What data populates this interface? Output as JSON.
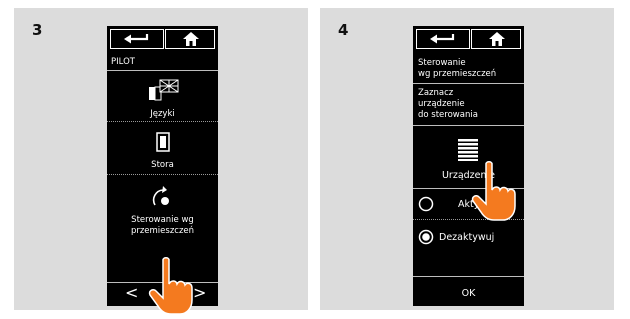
{
  "panels": [
    {
      "step": "3",
      "header": "PILOT",
      "items": [
        {
          "label": "Języki",
          "icon": "language-flags-icon"
        },
        {
          "label": "Stora",
          "icon": "blind-device-icon"
        },
        {
          "label_line1": "Sterowanie wg",
          "label_line2": "przemieszczeń",
          "icon": "motion-control-icon"
        }
      ],
      "nav": {
        "prev": "<",
        "next": ">"
      }
    },
    {
      "step": "4",
      "title_line1": "Sterowanie",
      "title_line2": "wg przemieszczeń",
      "subtitle_line1": "Zaznacz",
      "subtitle_line2": "urządzenie",
      "subtitle_line3": "do sterowania",
      "device_label": "Urządzenie",
      "options": [
        {
          "label": "Aktywuj",
          "selected": false
        },
        {
          "label": "Dezaktywuj",
          "selected": true
        }
      ],
      "ok": "OK"
    }
  ],
  "colors": {
    "background": "#dcdcdc",
    "screen": "#000000",
    "hand": "#f47a1f"
  }
}
